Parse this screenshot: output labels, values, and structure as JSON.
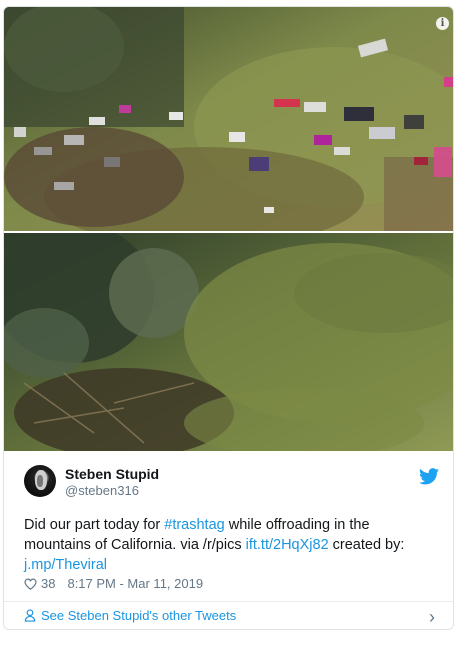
{
  "embed": {
    "info_icon": "info-icon",
    "images": [
      {
        "label": "photo-before",
        "description_icon": "image"
      },
      {
        "label": "photo-after",
        "description_icon": "image"
      }
    ]
  },
  "tweet": {
    "author_name": "Steben Stupid",
    "author_handle": "@steben316",
    "text_part1": "Did our part today for ",
    "hashtag": "#trashtag",
    "text_part2": " while offroading in the mountains of California. via /r/pics ",
    "link1": "ift.tt/2HqXj82",
    "text_part3": " created by: ",
    "link2": "j.mp/Theviral",
    "like_count": "38",
    "timestamp": "8:17 PM - Mar 11, 2019",
    "other_tweets_label": "See Steben Stupid's other Tweets"
  },
  "colors": {
    "link": "#1b95e0",
    "text": "#14171a",
    "muted": "#657786",
    "twitter_blue": "#1da1f2"
  }
}
